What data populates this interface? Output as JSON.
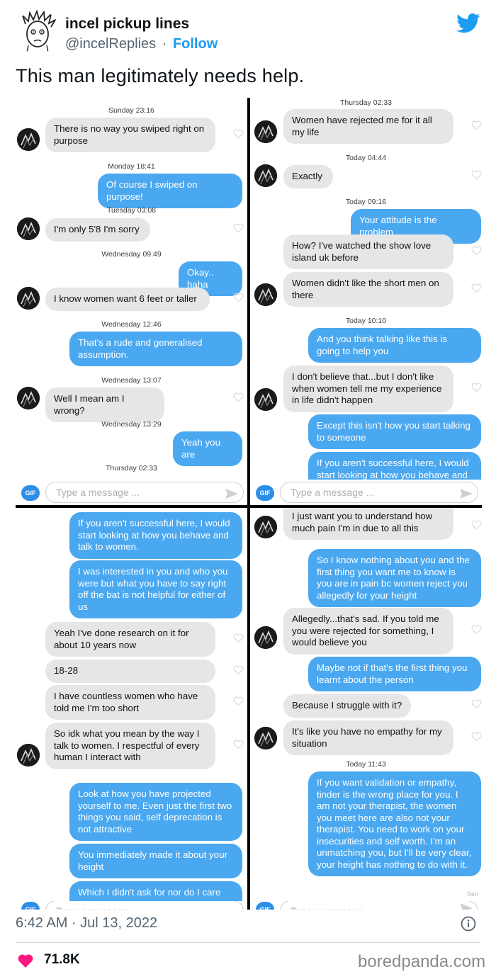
{
  "tweet": {
    "author_name": "incel pickup lines",
    "handle": "@incelReplies",
    "separator": "·",
    "follow_label": "Follow",
    "text": "This man legitimately needs help.",
    "timestamp": "6:42 AM · Jul 13, 2022",
    "likes": "71.8K"
  },
  "watermark": "boredpanda.com",
  "chat_common": {
    "gif_label": "GIF",
    "placeholder": "Type a message ...",
    "sent_label": "Sen"
  },
  "q1": {
    "ts_sunday": "Sunday 23:16",
    "m1": "There is no way you swiped right on purpose",
    "ts_monday": "Monday 18:41",
    "m2": "Of course I swiped on purpose!",
    "ts_tuesday": "Tuesday 03:08",
    "m3": "I'm only 5'8 I'm sorry",
    "ts_wed1": "Wednesday 09:49",
    "m4": "Okay.. haha",
    "m5": "I know women want 6 feet or taller",
    "ts_wed2": "Wednesday 12:46",
    "m6": "That's a rude and generalised assumption.",
    "ts_wed3": "Wednesday 13:07",
    "m7": "Well I mean am I wrong?",
    "ts_wed4": "Wednesday 13:29",
    "m8": "Yeah you are",
    "ts_thu": "Thursday 02:33"
  },
  "q2": {
    "ts_thu": "Thursday 02:33",
    "m1": "Women have rejected me for it all my life",
    "ts_today1": "Today 04:44",
    "m2": "Exactly",
    "ts_today2": "Today 09:16",
    "m3": "Your attitude is the problem",
    "m4": "How? I've watched the show love island uk before",
    "m5": "Women didn't like the short men on there",
    "ts_today3": "Today 10:10",
    "m6": "And you think talking like this is going to help you",
    "m7": "I don't believe that...but I don't like when women tell me my experience in life didn't happen",
    "m8": "Except this isn't how you start talking to someone",
    "m9": "If you aren't successful here, I would start looking at how you behave and"
  },
  "q3": {
    "m1": "If you aren't successful here, I would start looking at how you behave and talk to women.",
    "m2": "I was interested in you and who you were but what you have to say right off the bat is not helpful for either of us",
    "m3": "Yeah I've done research on it for about 10 years now",
    "m4": "18-28",
    "m5": "I have countless women who have told me I'm too short",
    "m6": "So idk what you mean by the way I talk to women. I respectful of every human I interact with",
    "m7": "Look at how you have projected yourself to me. Even just the first two things you said, self deprecation is not attractive",
    "m8": "You immediately made it about your height",
    "m9": "Which I didn't ask for nor do I care about"
  },
  "q4": {
    "m1": "I just want you to understand how much pain I'm in due to all this",
    "m2": "So I know nothing about you and the first thing you want me to know is you are in pain bc women reject you allegedly for your height",
    "m3": "Allegedly...that's sad. If you told me you were rejected for something, I would believe you",
    "m4": "Maybe not if that's the first thing you learnt about the person",
    "m5": "Because I struggle with it?",
    "m6": "It's like you have no empathy for my situation",
    "ts_today": "Today 11:43",
    "m7": "If you want validation or empathy, tinder is the wrong place for you. I am not your therapist, the women you meet here are also not your therapist. You need to work on your insecurities and self worth. I'm an unmatching you, but I'll be very clear, your height has nothing to do with it."
  },
  "colors": {
    "twitter_blue": "#1d9bf0",
    "outgoing_bubble": "#4aa8f0",
    "incoming_bubble": "#e6e6e6",
    "like_heart": "#f91880"
  },
  "icons": [
    "twitter-bird-icon",
    "info-icon",
    "heart-icon",
    "send-icon",
    "gif-icon"
  ]
}
